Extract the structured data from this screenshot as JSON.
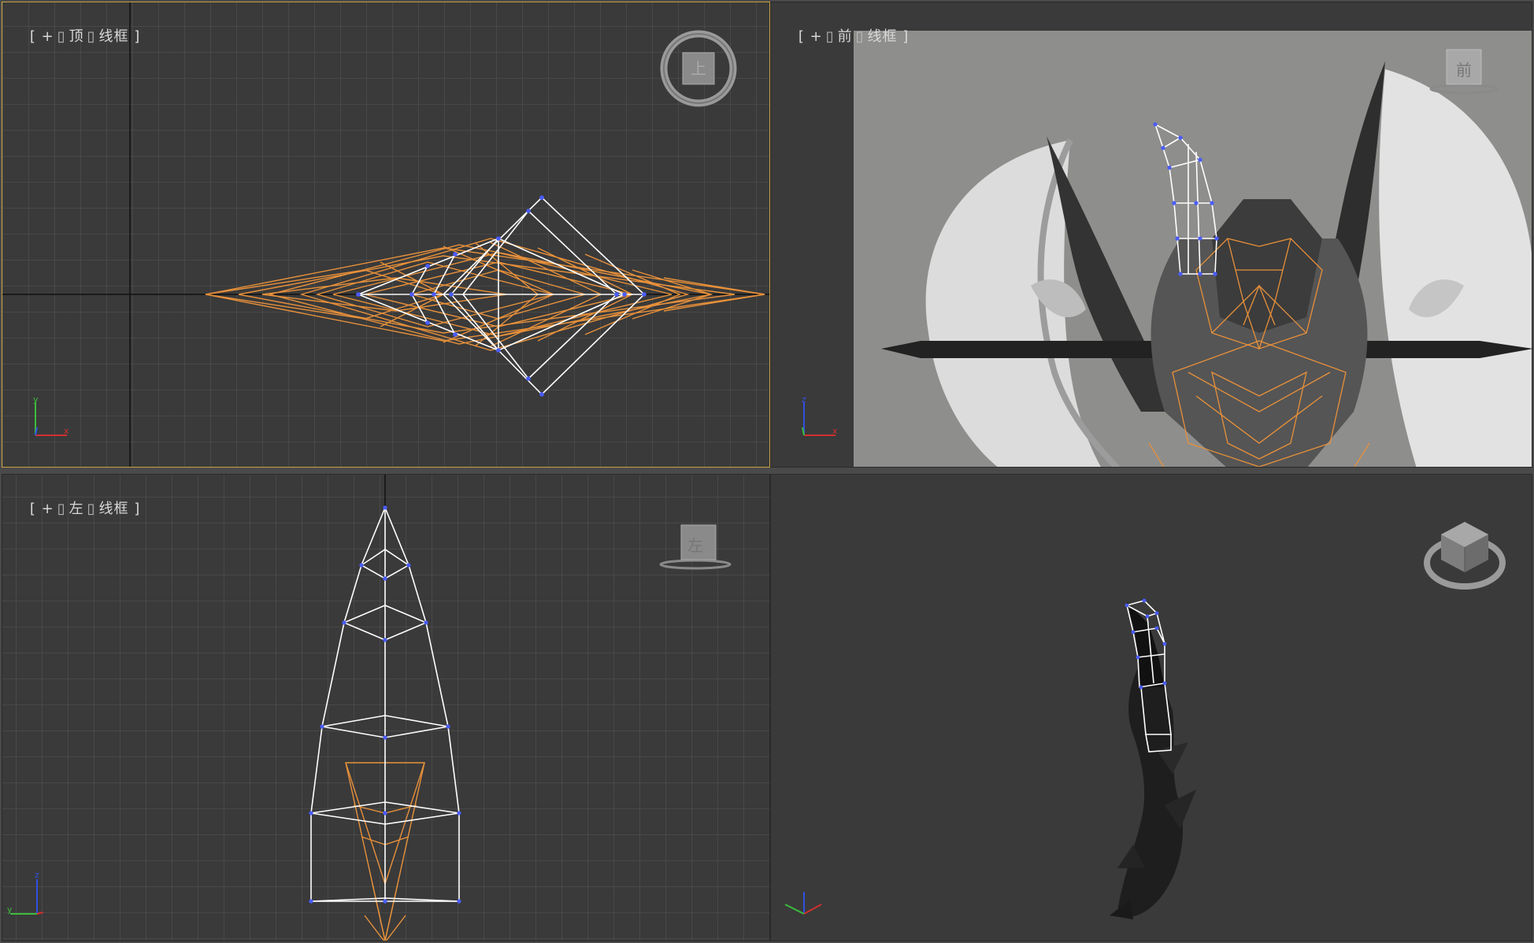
{
  "viewports": {
    "top": {
      "label": {
        "plus": "+",
        "view": "顶",
        "mode": "线框"
      },
      "navcube_label": "上",
      "axes": {
        "a": "y",
        "b": "x"
      }
    },
    "front": {
      "label": {
        "plus": "+",
        "view": "前",
        "mode": "线框"
      },
      "navcube_label": "前",
      "axes": {
        "a": "z",
        "b": "x"
      }
    },
    "left": {
      "label": {
        "plus": "+",
        "view": "左",
        "mode": "线框"
      },
      "navcube_label": "左",
      "axes": {
        "a": "z",
        "b": "y"
      }
    },
    "perspective": {
      "navcube_label": "",
      "axes": {
        "a": "z",
        "b": "x"
      }
    }
  },
  "colors": {
    "viewport_bg": "#3a3a3a",
    "grid": "#5a5a5a",
    "wire_selected": "#ffffff",
    "wire_ref": "#e8913a",
    "vertex": "#4a5cff",
    "active_border": "#c8a040"
  }
}
